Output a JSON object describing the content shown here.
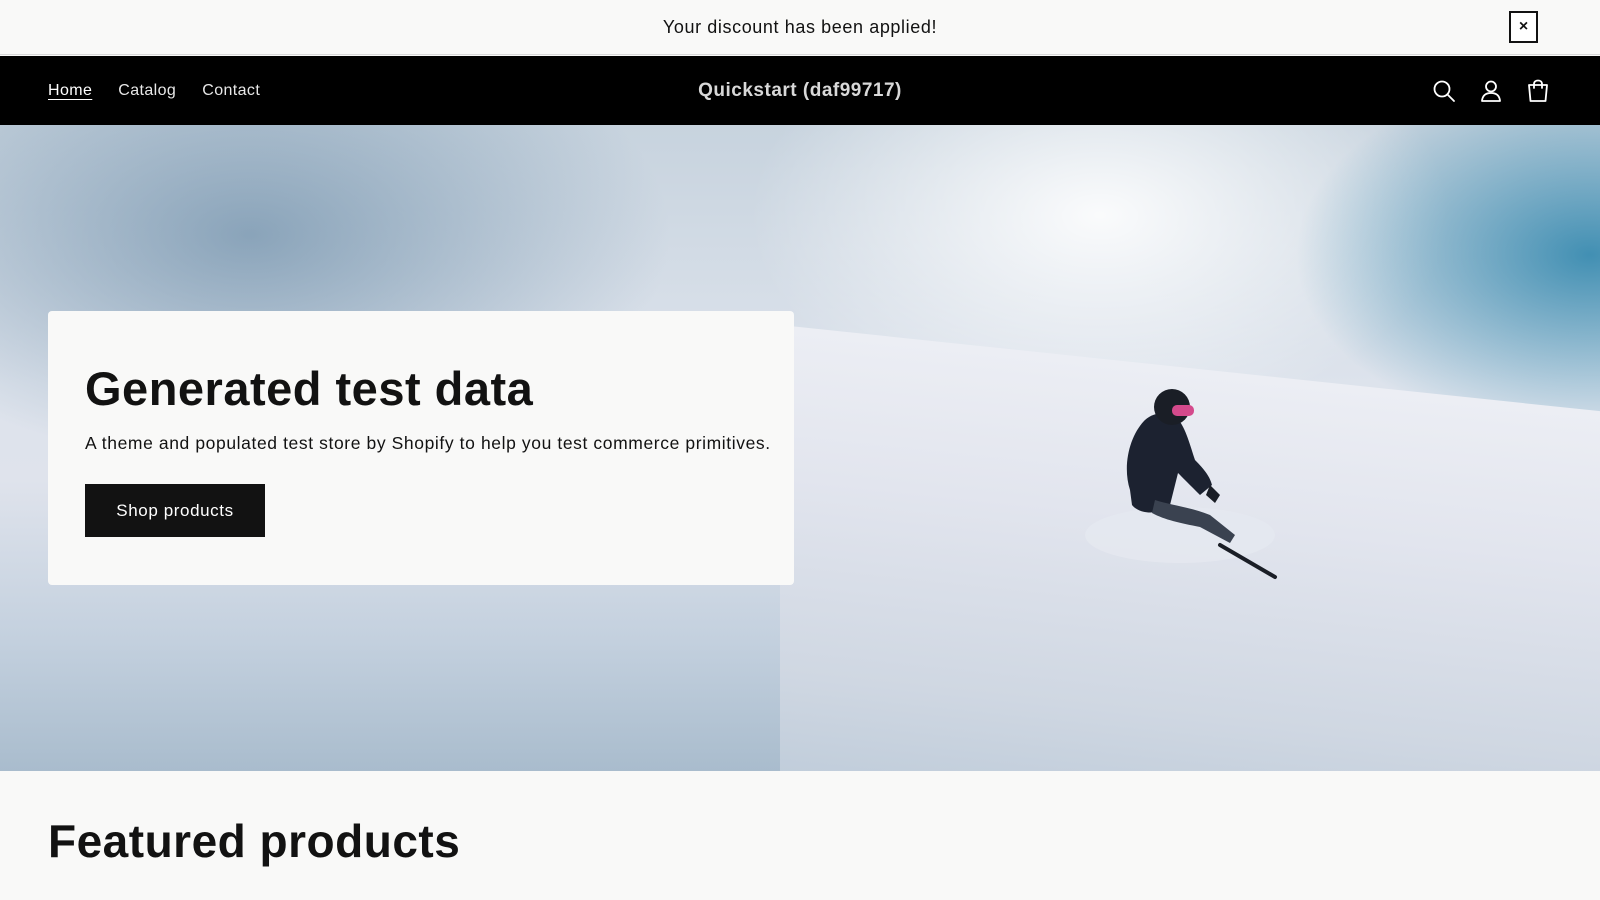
{
  "announcement": {
    "text": "Your discount has been applied!",
    "close_label": "×"
  },
  "header": {
    "nav": [
      {
        "label": "Home",
        "active": true
      },
      {
        "label": "Catalog",
        "active": false
      },
      {
        "label": "Contact",
        "active": false
      }
    ],
    "store_name": "Quickstart (daf99717)",
    "icons": [
      "search-icon",
      "account-icon",
      "cart-icon"
    ]
  },
  "hero": {
    "title": "Generated test data",
    "subtitle": "A theme and populated test store by Shopify to help you test commerce primitives.",
    "button_label": "Shop products",
    "image": "snowboarder-on-snowy-slope"
  },
  "featured": {
    "title": "Featured products"
  },
  "colors": {
    "header_bg": "#000000",
    "page_bg": "#f9f9f8",
    "button_bg": "#121212",
    "text": "#121212"
  }
}
